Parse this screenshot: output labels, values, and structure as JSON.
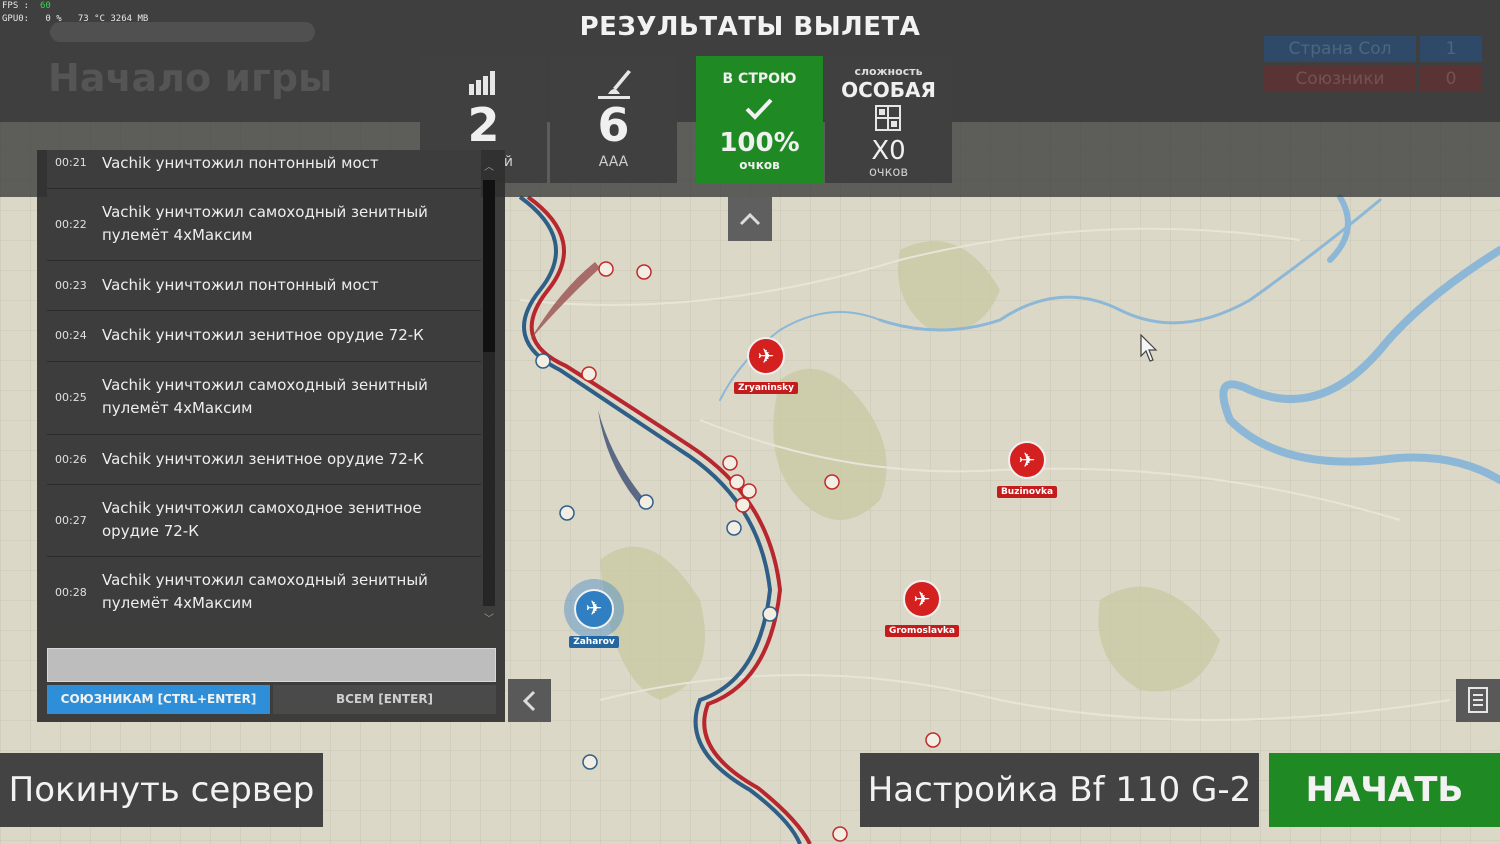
{
  "debug": {
    "fps_label": "FPS :",
    "fps_value": "60",
    "gpu_label": "GPU0:",
    "gpu_value": "0 %   73 °C 3264 MB"
  },
  "background": {
    "title": "Начало игры",
    "team_allies": "Союзники",
    "team_allies_value": "0",
    "team_country": "Страна Сол",
    "team_country_value": "1"
  },
  "header": {
    "title": "РЕЗУЛЬТАТЫ ВЫЛЕТА"
  },
  "stats": [
    {
      "value": "2",
      "label": "й",
      "icon": "building-icon"
    },
    {
      "value": "6",
      "label": "AAA",
      "icon": "aa-gun-icon"
    }
  ],
  "status": {
    "label": "В СТРОЮ",
    "percent": "100%",
    "points_label": "очков",
    "icon": "check-icon",
    "color": "#1f8a23"
  },
  "difficulty": {
    "caption": "сложность",
    "value": "ОСОБАЯ",
    "multiplier": "X0",
    "points_label": "очков",
    "icon": "settings-grid-icon"
  },
  "chat": {
    "messages": [
      {
        "time": "00:21",
        "text": "Vachik уничтожил понтонный мост"
      },
      {
        "time": "00:22",
        "text": "Vachik уничтожил самоходный зенитный пулемёт 4хМаксим"
      },
      {
        "time": "00:23",
        "text": "Vachik уничтожил понтонный мост"
      },
      {
        "time": "00:24",
        "text": "Vachik уничтожил зенитное орудие 72-К"
      },
      {
        "time": "00:25",
        "text": "Vachik уничтожил самоходный зенитный пулемёт 4хМаксим"
      },
      {
        "time": "00:26",
        "text": "Vachik уничтожил зенитное орудие 72-К"
      },
      {
        "time": "00:27",
        "text": "Vachik уничтожил самоходное зенитное орудие 72-К"
      },
      {
        "time": "00:28",
        "text": "Vachik уничтожил самоходный зенитный пулемёт 4хМаксим"
      }
    ],
    "input_value": "",
    "allies_button": "СОЮЗНИКАМ [CTRL+ENTER]",
    "all_button": "ВСЕМ [ENTER]"
  },
  "map": {
    "airfields": [
      {
        "name": "Zryaninsky",
        "side": "red"
      },
      {
        "name": "Buzinovka",
        "side": "red"
      },
      {
        "name": "Gromoslavka",
        "side": "red"
      },
      {
        "name": "Zaharov",
        "side": "blue"
      }
    ],
    "colors": {
      "red_front": "#b8262e",
      "blue_front": "#2f5e86"
    }
  },
  "buttons": {
    "leave": "Покинуть сервер",
    "setup": "Настройка Bf 110 G-2",
    "start": "НАЧАТЬ"
  }
}
